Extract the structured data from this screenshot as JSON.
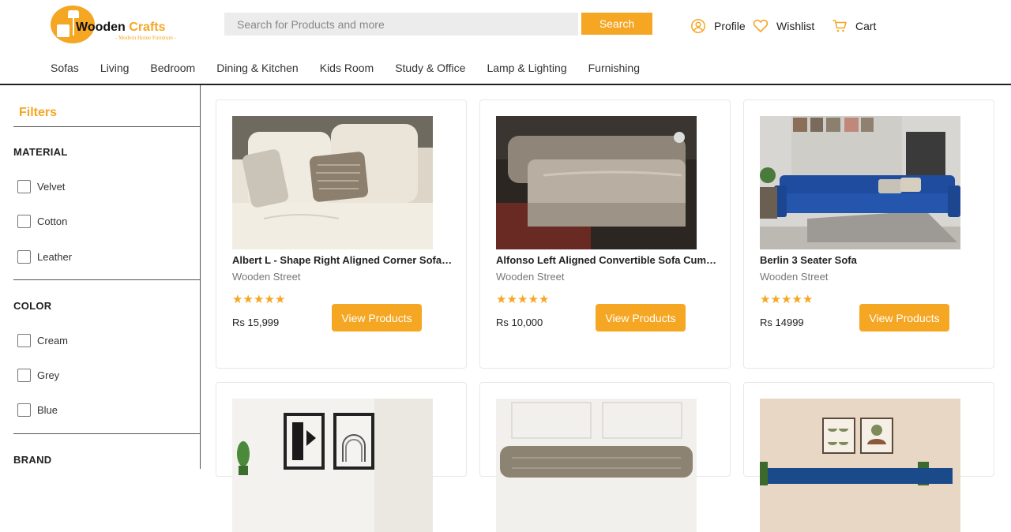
{
  "brand": {
    "name_part1": "Wooden",
    "name_part2": " Crafts",
    "tagline": "- Modern Home Furniture -",
    "accent_color": "#f5a623"
  },
  "search": {
    "placeholder": "Search for Products and more",
    "button_label": "Search"
  },
  "header_links": {
    "profile": "Profile",
    "wishlist": "Wishlist",
    "cart": "Cart"
  },
  "nav": [
    "Sofas",
    "Living",
    "Bedroom",
    "Dining & Kitchen",
    "Kids Room",
    "Study & Office",
    "Lamp & Lighting",
    "Furnishing"
  ],
  "filters": {
    "title": "Filters",
    "sections": [
      {
        "title": "MATERIAL",
        "options": [
          "Velvet",
          "Cotton",
          "Leather"
        ]
      },
      {
        "title": "COLOR",
        "options": [
          "Cream",
          "Grey",
          "Blue"
        ]
      },
      {
        "title": "BRAND",
        "options": []
      }
    ]
  },
  "products": [
    {
      "title": "Albert L - Shape Right Aligned Corner Sofa Set (Fabric, Cream)",
      "brand": "Wooden Street",
      "rating": 5,
      "price": "Rs 15,999",
      "cta": "View Products"
    },
    {
      "title": "Alfonso Left Aligned Convertible Sofa Cum Bed (Fabric, Grey)",
      "brand": "Wooden Street",
      "rating": 5,
      "price": "Rs 10,000",
      "cta": "View Products"
    },
    {
      "title": "Berlin 3 Seater Sofa",
      "brand": "Wooden Street",
      "rating": 5,
      "price": "Rs 14999",
      "cta": "View Products"
    },
    {
      "title": "",
      "brand": "",
      "rating": 0,
      "price": "",
      "cta": ""
    },
    {
      "title": "",
      "brand": "",
      "rating": 0,
      "price": "",
      "cta": ""
    },
    {
      "title": "",
      "brand": "",
      "rating": 0,
      "price": "",
      "cta": ""
    }
  ]
}
